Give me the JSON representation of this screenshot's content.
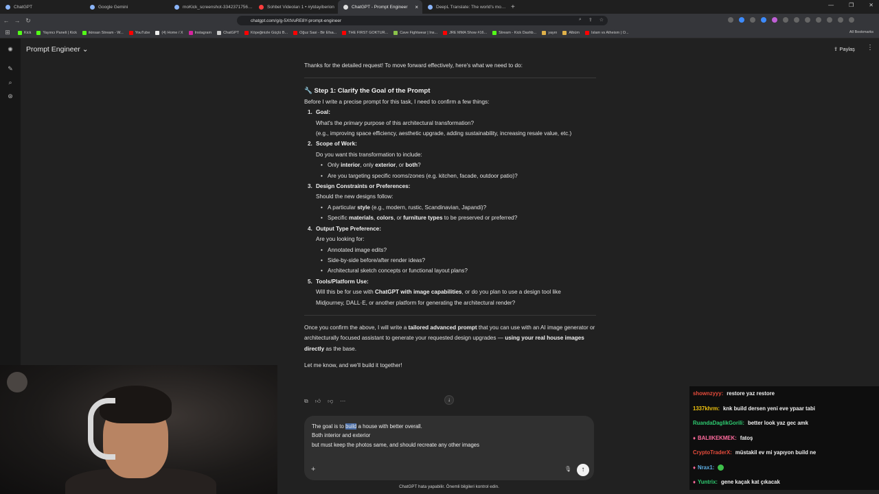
{
  "browser": {
    "tabs": [
      {
        "label": "ChatGPT",
        "active": false
      },
      {
        "label": "Google Gemini",
        "active": false
      },
      {
        "label": "moKick_screenshot-3342371756.png",
        "active": false
      },
      {
        "label": "Sohbet Videoları 1 • #ytdayiberion",
        "active": false
      },
      {
        "label": "ChatGPT - Prompt Engineer",
        "active": true
      },
      {
        "label": "DeepL Translate: The world's most a…",
        "active": false
      }
    ],
    "url": "chatgpt.com/g/g-5XtVuRE8Y-prompt-engineer",
    "bookmarks": [
      "Kick",
      "Yayıncı Paneli | Kick",
      "ikinsan Stream - W...",
      "YouTube",
      "(4) Home / X",
      "Instagram",
      "ChatGPT",
      "Köpeğinizle Güçlü B...",
      "Oğuz Sasi - Bir Efsa...",
      "THE FIRST GOKTUR...",
      "Cave Fightwear | Ins...",
      "JRE MMA Show #16...",
      "Stream - Kick Dashb...",
      "yayın",
      "Albüm",
      "Islam vs Atheism | O..."
    ],
    "all_bookmarks": "All Bookmarks"
  },
  "header": {
    "model_name": "Prompt Engineer",
    "share_label": "Paylaş"
  },
  "response": {
    "intro": "Thanks for the detailed request! To move forward effectively, here's what we need to do:",
    "step_icon": "🔧",
    "step_title": "Step 1: Clarify the Goal of the Prompt",
    "step_lead": "Before I write a precise prompt for this task, I need to confirm a few things:",
    "items": [
      {
        "num": "1.",
        "title": "Goal:",
        "q_pre": "What's the ",
        "q_em": "primary",
        "q_post": " purpose of this architectural transformation?",
        "q2": "(e.g., improving space efficiency, aesthetic upgrade, adding sustainability, increasing resale value, etc.)"
      },
      {
        "num": "2.",
        "title": "Scope of Work:",
        "q": "Do you want this transformation to include:",
        "b1_pre": "Only ",
        "b1_a": "interior",
        "b1_mid1": ", only ",
        "b1_b": "exterior",
        "b1_mid2": ", or ",
        "b1_c": "both",
        "b1_post": "?",
        "b2": "Are you targeting specific rooms/zones (e.g. kitchen, facade, outdoor patio)?"
      },
      {
        "num": "3.",
        "title": "Design Constraints or Preferences:",
        "q": "Should the new designs follow:",
        "b1_pre": "A particular ",
        "b1_a": "style",
        "b1_post": " (e.g., modern, rustic, Scandinavian, Japandi)?",
        "b2_pre": "Specific ",
        "b2_a": "materials",
        "b2_m1": ", ",
        "b2_b": "colors",
        "b2_m2": ", or ",
        "b2_c": "furniture types",
        "b2_post": " to be preserved or preferred?"
      },
      {
        "num": "4.",
        "title": "Output Type Preference:",
        "q": "Are you looking for:",
        "b1": "Annotated image edits?",
        "b2": "Side-by-side before/after render ideas?",
        "b3": "Architectural sketch concepts or functional layout plans?"
      },
      {
        "num": "5.",
        "title": "Tools/Platform Use:",
        "q_pre": "Will this be for use with ",
        "q_b": "ChatGPT with image capabilities",
        "q_post": ", or do you plan to use a design tool like",
        "q2": "Midjourney, DALL·E, or another platform for generating the architectural render?"
      }
    ],
    "outro_pre": "Once you confirm the above, I will write a ",
    "outro_b1": "tailored advanced prompt",
    "outro_mid": " that you can use with an AI image generator or architecturally focused assistant to generate your requested design upgrades — ",
    "outro_b2": "using your real house images directly",
    "outro_post": " as the base.",
    "closing": "Let me know, and we'll build it together!"
  },
  "composer": {
    "line1_pre": "The goal is to ",
    "line1_hl": "build",
    "line1_post": " a house with better overall.",
    "line2": "Both interior and exterior",
    "line3": "but must keep the photos same, and should recreate any other images"
  },
  "footer": "ChatGPT hata yapabilir. Önemli bilgileri kontrol edin.",
  "stream_chat": [
    {
      "user": "shownzyyy:",
      "text": "restore yaz restore",
      "color": "#e74c3c"
    },
    {
      "user": "1337khrm:",
      "text": "knk build dersen yeni eve ypaar tabi",
      "color": "#f1c40f"
    },
    {
      "user": "RuandaDaglikGorili:",
      "text": "better look yaz gec amk",
      "color": "#2ecc71"
    },
    {
      "user": "BALIIKEKMEK:",
      "text": "fatoş",
      "color": "#ff6b9d"
    },
    {
      "user": "CryptoTraderX:",
      "text": "müstakil ev mi yapıyon build ne",
      "color": "#e74c3c"
    },
    {
      "user": "Nrax1:",
      "text": "",
      "color": "#5dade2"
    },
    {
      "user": "Yuntrix:",
      "text": "gene kaçak kat çıkacak",
      "color": "#2ecc71"
    }
  ]
}
